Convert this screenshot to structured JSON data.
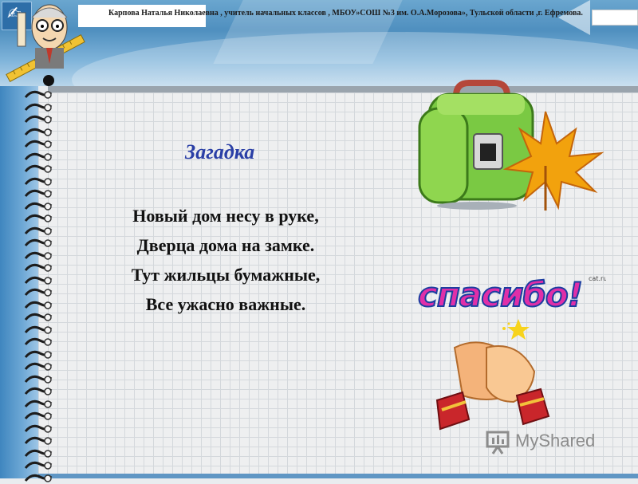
{
  "header": {
    "author_credit": "Карпова Наталья Николаевна , учитель начальных классов , МБОУ»СОШ №3 им. О.А.Морозова», Тульской области ,г. Ефремова."
  },
  "slide": {
    "title": "Загадка",
    "riddle_lines": [
      "Новый дом несу в руке,",
      "Дверца дома на замке.",
      "Тут жильцы бумажные,",
      "Все ужасно важные."
    ],
    "thanks_text": "спасибо!",
    "thanks_small_tag": "cat.ru"
  },
  "watermark": {
    "text": "MyShared"
  },
  "colors": {
    "title": "#2a3fa6",
    "thanks_fill": "#e02fa8",
    "header_blue": "#4f8fbf"
  }
}
